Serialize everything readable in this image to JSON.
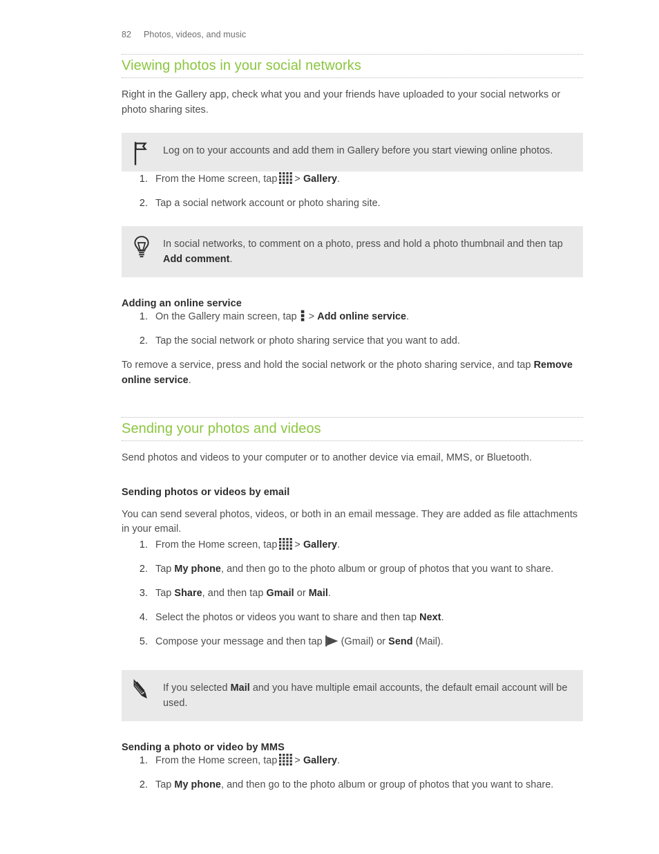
{
  "document": {
    "page_number": "82",
    "running_header": "Photos, videos, and music"
  },
  "accent_color": "#8bc53f",
  "sections": [
    {
      "heading": "Viewing photos in your social networks",
      "intro": "Right in the Gallery app, check what you and your friends have uploaded to your social networks or photo sharing sites.",
      "note_flag": "Log on to your accounts and add them in Gallery before you start viewing online photos.",
      "steps": [
        {
          "num": "1.",
          "pre": "From the Home screen, tap",
          "icon": "apps-grid-icon",
          "mid": ">",
          "bold": "Gallery",
          "post": "."
        },
        {
          "num": "2.",
          "text": "Tap a social network account or photo sharing site."
        }
      ],
      "tip": {
        "pre": "In social networks, to comment on a photo, press and hold a photo thumbnail and then tap",
        "bold": "Add comment",
        "post": "."
      },
      "subsection": {
        "heading": "Adding an online service",
        "steps": [
          {
            "num": "1.",
            "pre": "On the Gallery main screen, tap",
            "icon": "overflow-menu-icon",
            "mid": ">",
            "bold": "Add online service",
            "post": "."
          },
          {
            "num": "2.",
            "text": "Tap the social network or photo sharing service that you want to add."
          }
        ],
        "outro_pre": "To remove a service, press and hold the social network or the photo sharing service, and tap",
        "outro_bold": "Remove online service",
        "outro_post": "."
      }
    },
    {
      "heading": "Sending your photos and videos",
      "intro": "Send photos and videos to your computer or to another device via email, MMS, or Bluetooth.",
      "subsections": [
        {
          "heading": "Sending photos or videos by email",
          "intro": "You can send several photos, videos, or both in an email message. They are added as file attachments in your email.",
          "steps": [
            {
              "num": "1.",
              "pre": "From the Home screen, tap",
              "icon": "apps-grid-icon",
              "mid": ">",
              "bold": "Gallery",
              "post": "."
            },
            {
              "num": "2.",
              "pre": "Tap",
              "bold": "My phone",
              "post": ", and then go to the photo album or group of photos that you want to share."
            },
            {
              "num": "3.",
              "pre": "Tap",
              "bold": "Share",
              "mid2": ", and then tap",
              "bold2": "Gmail",
              "mid3": "or",
              "bold3": "Mail",
              "post": "."
            },
            {
              "num": "4.",
              "pre": "Select the photos or videos you want to share and then tap",
              "bold": "Next",
              "post": "."
            },
            {
              "num": "5.",
              "pre": "Compose your message and then tap",
              "icon": "send-arrow-icon",
              "mid": "(Gmail) or",
              "bold": "Send",
              "post": "(Mail)."
            }
          ],
          "note_pencil": {
            "pre": "If you selected",
            "bold": "Mail",
            "post": "and you have multiple email accounts, the default email account will be used."
          }
        },
        {
          "heading": "Sending a photo or video by MMS",
          "steps": [
            {
              "num": "1.",
              "pre": "From the Home screen, tap",
              "icon": "apps-grid-icon",
              "mid": ">",
              "bold": "Gallery",
              "post": "."
            },
            {
              "num": "2.",
              "pre": "Tap",
              "bold": "My phone",
              "post": ", and then go to the photo album or group of photos that you want to share."
            }
          ]
        }
      ]
    }
  ]
}
